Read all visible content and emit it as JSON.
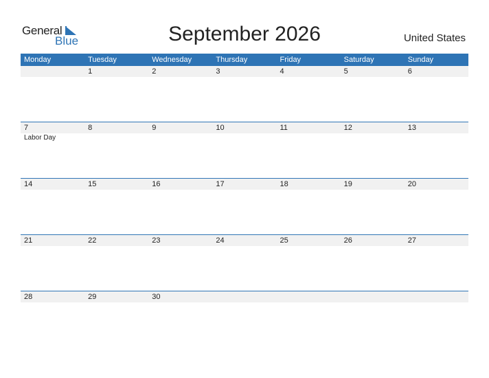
{
  "logo": {
    "general": "General",
    "blue": "Blue"
  },
  "title": "September 2026",
  "country": "United States",
  "colors": {
    "accent": "#2e74b5",
    "row_bg": "#f1f1f1"
  },
  "weekdays": [
    "Monday",
    "Tuesday",
    "Wednesday",
    "Thursday",
    "Friday",
    "Saturday",
    "Sunday"
  ],
  "weeks": [
    {
      "days": [
        "",
        "1",
        "2",
        "3",
        "4",
        "5",
        "6"
      ],
      "events": [
        "",
        "",
        "",
        "",
        "",
        "",
        ""
      ]
    },
    {
      "days": [
        "7",
        "8",
        "9",
        "10",
        "11",
        "12",
        "13"
      ],
      "events": [
        "Labor Day",
        "",
        "",
        "",
        "",
        "",
        ""
      ]
    },
    {
      "days": [
        "14",
        "15",
        "16",
        "17",
        "18",
        "19",
        "20"
      ],
      "events": [
        "",
        "",
        "",
        "",
        "",
        "",
        ""
      ]
    },
    {
      "days": [
        "21",
        "22",
        "23",
        "24",
        "25",
        "26",
        "27"
      ],
      "events": [
        "",
        "",
        "",
        "",
        "",
        "",
        ""
      ]
    },
    {
      "days": [
        "28",
        "29",
        "30",
        "",
        "",
        "",
        ""
      ],
      "events": [
        "",
        "",
        "",
        "",
        "",
        "",
        ""
      ]
    }
  ]
}
